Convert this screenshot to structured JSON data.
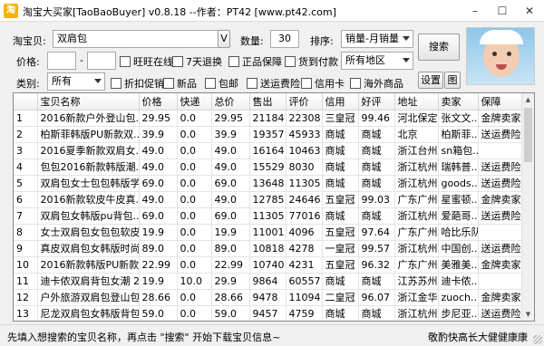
{
  "window": {
    "title": "淘宝大买家[TaoBaoBuyer] v0.8.18 --作者：PT42 [www.pt42.com]",
    "app_icon": "淘"
  },
  "controls": {
    "keyword_label": "淘宝贝:",
    "keyword_value": "双肩包",
    "keyword_btn": "V",
    "count_label": "数量:",
    "count_value": "30",
    "sort_label": "排序:",
    "sort_value": "销量-月销量",
    "search_btn": "搜索",
    "price_label": "价格:",
    "price_min": "",
    "price_sep": "-",
    "price_max": "",
    "region_value": "所有地区",
    "category_label": "类别:",
    "category_value": "所有",
    "settings_btn": "设置",
    "image_btn": "图",
    "checkboxes_row1": [
      "旺旺在线",
      "7天退换",
      "正品保障",
      "货到付款"
    ],
    "checkboxes_row2": [
      "折扣促销",
      "新品",
      "包邮",
      "送运费险",
      "信用卡",
      "海外商品"
    ]
  },
  "table": {
    "headers": [
      "",
      "宝贝名称",
      "价格",
      "快递",
      "总价",
      "售出",
      "评价",
      "信用",
      "好评",
      "地址",
      "卖家",
      "保障"
    ],
    "rows": [
      [
        "1",
        "2016新款户外登山包...",
        "29.95",
        "0.0",
        "29.95",
        "21184",
        "22308",
        "三皇冠",
        "99.46",
        "河北保定",
        "张文文...",
        "金牌卖家"
      ],
      [
        "2",
        "柏斯菲韩版PU新款双...",
        "39.9",
        "0.0",
        "39.9",
        "19357",
        "45933",
        "商城",
        "商城",
        "北京",
        "柏斯菲...",
        "送运费险"
      ],
      [
        "3",
        "2016夏季新款双肩女...",
        "49.0",
        "0.0",
        "49.0",
        "16164",
        "10463",
        "商城",
        "商城",
        "浙江台州",
        "sn箱包...",
        ""
      ],
      [
        "4",
        "包包2016新款韩版潮...",
        "49.0",
        "0.0",
        "49.0",
        "15529",
        "8030",
        "商城",
        "商城",
        "浙江杭州",
        "瑞韩普...",
        "送运费险"
      ],
      [
        "5",
        "双肩包女士包包韩版学...",
        "69.0",
        "0.0",
        "69.0",
        "13648",
        "11305",
        "商城",
        "商城",
        "浙江杭州",
        "goods...",
        "送运费险"
      ],
      [
        "6",
        "2016新款软皮牛皮真...",
        "49.0",
        "0.0",
        "49.0",
        "12785",
        "24646",
        "五皇冠",
        "99.03",
        "广东广州",
        "星蜜顿...",
        "金牌卖家"
      ],
      [
        "7",
        "双肩包女韩版pu背包...",
        "69.0",
        "0.0",
        "69.0",
        "11305",
        "77016",
        "商城",
        "商城",
        "浙江杭州",
        "爱葩哥...",
        "送运费险"
      ],
      [
        "8",
        "女士双肩包女包包软皮...",
        "19.9",
        "0.0",
        "19.9",
        "11001",
        "4096",
        "五皇冠",
        "97.64",
        "广东广州",
        "哈比乐队",
        ""
      ],
      [
        "9",
        "真皮双肩包女韩版时尚...",
        "89.0",
        "0.0",
        "89.0",
        "10818",
        "4278",
        "一皇冠",
        "99.57",
        "浙江杭州",
        "中国创...",
        "送运费险"
      ],
      [
        "10",
        "2016新款韩版PU新款双...",
        "22.99",
        "0.0",
        "22.99",
        "10740",
        "4231",
        "五皇冠",
        "96.32",
        "广东广州",
        "美雅美...",
        "金牌卖家"
      ],
      [
        "11",
        "迪卡侬双肩背包女潮 2...",
        "19.9",
        "10.0",
        "29.9",
        "9864",
        "60557",
        "商城",
        "商城",
        "江苏苏州",
        "迪卡侬...",
        ""
      ],
      [
        "12",
        "户外旅游双肩包登山包...",
        "28.66",
        "0.0",
        "28.66",
        "9478",
        "11094",
        "二皇冠",
        "96.07",
        "浙江金华",
        "zuoch...",
        "金牌卖家"
      ],
      [
        "13",
        "尼龙双肩包女韩版背包...",
        "59.0",
        "0.0",
        "59.0",
        "9457",
        "4759",
        "商城",
        "商城",
        "浙江杭州",
        "步尼亚...",
        "送运费险"
      ],
      [
        "14",
        "双肩包女旅行背包韩版...",
        "22.99",
        "0.0",
        "22.99",
        "9321",
        "5734",
        "五皇冠",
        "96.32",
        "广东广州",
        "美雅美...",
        "金牌卖家"
      ],
      [
        "15",
        "韩版双肩包女帆布学...",
        "45.8",
        "0.0",
        "45.8",
        "9010",
        "6218",
        "四皇冠",
        "98.12",
        "广东广州",
        "韩潮包...",
        "金牌卖家"
      ]
    ]
  },
  "status": {
    "left": "先填入想搜索的宝贝名称，再点击 \"搜索\" 开始下载宝贝信息~",
    "right": "敬酌快高长大健健康康"
  }
}
